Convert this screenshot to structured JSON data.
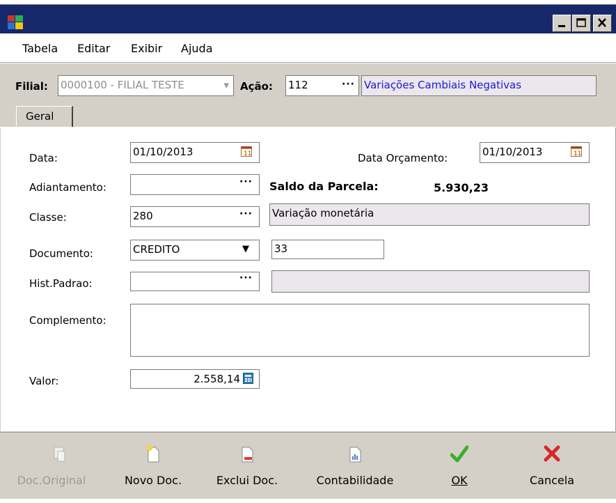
{
  "menu": {
    "items": [
      "Tabela",
      "Editar",
      "Exibir",
      "Ajuda"
    ]
  },
  "header": {
    "filial_label": "Filial:",
    "filial_value": "0000100 - FILIAL TESTE",
    "acao_label": "Ação:",
    "acao_value": "112",
    "acao_desc": "Variações Cambiais Negativas"
  },
  "tabs": [
    "Geral"
  ],
  "form": {
    "data_label": "Data:",
    "data_value": "01/10/2013",
    "data_orc_label": "Data Orçamento:",
    "data_orc_value": "01/10/2013",
    "adiantamento_label": "Adiantamento:",
    "adiantamento_value": "",
    "saldo_label": "Saldo da Parcela:",
    "saldo_value": "5.930,23",
    "classe_label": "Classe:",
    "classe_value": "280",
    "classe_desc": "Variação monetária",
    "documento_label": "Documento:",
    "documento_value": "CREDITO",
    "documento_num": "33",
    "hist_label": "Hist.Padrao:",
    "hist_value": "",
    "hist_desc": "",
    "complemento_label": "Complemento:",
    "complemento_value": "",
    "valor_label": "Valor:",
    "valor_value": "2.558,14"
  },
  "toolbar": {
    "doc_original": "Doc.Original",
    "novo_doc": "Novo Doc.",
    "exclui_doc": "Exclui Doc.",
    "contabilidade": "Contabilidade",
    "ok": "OK",
    "cancela": "Cancela"
  },
  "colors": {
    "titlebar": "#16276a",
    "panel": "#d4d0c8",
    "link_blue": "#1a1ad6",
    "ok_green": "#3cae2a",
    "cancel_red": "#d8262a"
  }
}
